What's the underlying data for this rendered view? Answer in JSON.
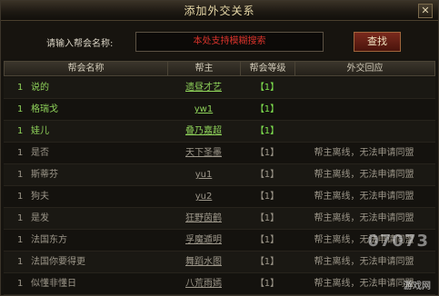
{
  "window": {
    "title": "添加外交关系",
    "close_glyph": "✕"
  },
  "search": {
    "label": "请输入帮会名称:",
    "placeholder": "本处支持模糊搜索",
    "button": "查找"
  },
  "table": {
    "headers": [
      "帮会名称",
      "帮主",
      "帮会等级",
      "外交回应"
    ],
    "rows": [
      {
        "index": "1",
        "name": "说的",
        "leader": "遗昼才艺",
        "level": "【1】",
        "response": "",
        "status": "ally"
      },
      {
        "index": "1",
        "name": "格瑞戈",
        "leader": "yw1",
        "level": "【1】",
        "response": "",
        "status": "ally"
      },
      {
        "index": "1",
        "name": "娃儿",
        "leader": "叠乃嘉超",
        "level": "【1】",
        "response": "",
        "status": "ally"
      },
      {
        "index": "1",
        "name": "是否",
        "leader": "天下圣墨",
        "level": "【1】",
        "response": "帮主离线，无法申请同盟",
        "status": "none"
      },
      {
        "index": "1",
        "name": "斯蒂芬",
        "leader": "yu1",
        "level": "【1】",
        "response": "帮主离线，无法申请同盟",
        "status": "none"
      },
      {
        "index": "1",
        "name": "狗夫",
        "leader": "yu2",
        "level": "【1】",
        "response": "帮主离线，无法申请同盟",
        "status": "none"
      },
      {
        "index": "1",
        "name": "是发",
        "leader": "狂野茵鹤",
        "level": "【1】",
        "response": "帮主离线，无法申请同盟",
        "status": "none"
      },
      {
        "index": "1",
        "name": "法国东方",
        "leader": "孚魔遁明",
        "level": "【1】",
        "response": "帮主离线，无法申请同盟",
        "status": "none"
      },
      {
        "index": "1",
        "name": "法国你要得更",
        "leader": "舞蹈水图",
        "level": "【1】",
        "response": "帮主离线，无法申请同盟",
        "status": "none"
      },
      {
        "index": "1",
        "name": "似懂非懂日",
        "leader": "八荒雨嫣",
        "level": "【1】",
        "response": "帮主离线，无法申请同盟",
        "status": "none"
      }
    ]
  },
  "watermark": {
    "brand": "07073",
    "sub": "游戏网"
  },
  "colors": {
    "ally_text": "#8fd35a",
    "placeholder_red": "#d9332b",
    "title_gold": "#e8d9a8"
  }
}
